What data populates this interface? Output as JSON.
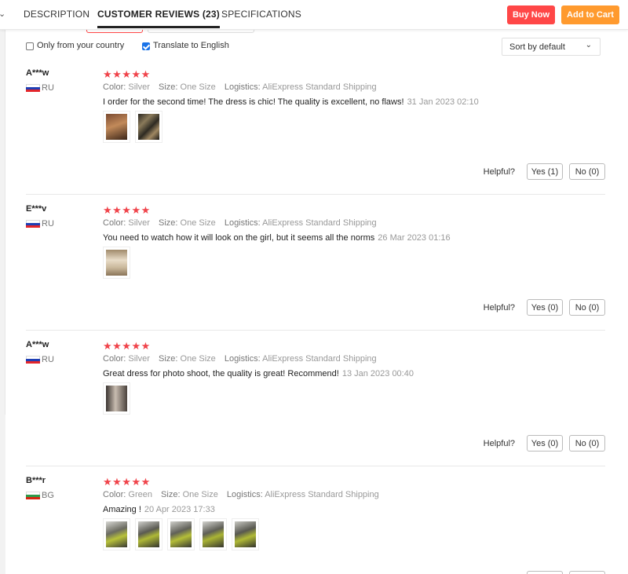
{
  "tabs": {
    "description": "DESCRIPTION",
    "reviews": "CUSTOMER REVIEWS (23)",
    "specifications": "SPECIFICATIONS"
  },
  "actions": {
    "buy_now": "Buy Now",
    "add_to_cart": "Add to Cart"
  },
  "colors": {
    "buy_now": "#ff4747",
    "add_to_cart": "#ff9a2e",
    "stars": "#f0434a"
  },
  "filters": {
    "only_country": "Only from your country",
    "only_country_checked": false,
    "translate": "Translate to English",
    "translate_checked": true,
    "sort": "Sort by default"
  },
  "labels": {
    "color": "Color:",
    "size": "Size:",
    "logistics": "Logistics:",
    "helpful": "Helpful?",
    "stars": "★★★★★"
  },
  "reviews": [
    {
      "name": "A***w",
      "country": "RU",
      "rating": 5,
      "color": "Silver",
      "size": "One Size",
      "logistics": "AliExpress Standard Shipping",
      "text": "I order for the second time! The dress is chic! The quality is excellent, no flaws!",
      "date": "31 Jan 2023 02:10",
      "yes": "Yes (1)",
      "no": "No (0)"
    },
    {
      "name": "E***v",
      "country": "RU",
      "rating": 5,
      "color": "Silver",
      "size": "One Size",
      "logistics": "AliExpress Standard Shipping",
      "text": "You need to watch how it will look on the girl, but it seems all the norms",
      "date": "26 Mar 2023 01:16",
      "yes": "Yes (0)",
      "no": "No (0)"
    },
    {
      "name": "A***w",
      "country": "RU",
      "rating": 5,
      "color": "Silver",
      "size": "One Size",
      "logistics": "AliExpress Standard Shipping",
      "text": "Great dress for photo shoot, the quality is great! Recommend!",
      "date": "13 Jan 2023 00:40",
      "yes": "Yes (0)",
      "no": "No (0)"
    },
    {
      "name": "B***r",
      "country": "BG",
      "rating": 5,
      "color": "Green",
      "size": "One Size",
      "logistics": "AliExpress Standard Shipping",
      "text": "Amazing !",
      "date": "20 Apr 2023 17:33",
      "yes": "",
      "no": ""
    }
  ]
}
